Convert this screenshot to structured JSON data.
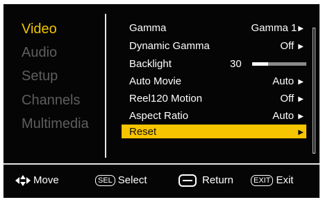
{
  "categories": [
    {
      "label": "Video",
      "active": true
    },
    {
      "label": "Audio",
      "active": false
    },
    {
      "label": "Setup",
      "active": false
    },
    {
      "label": "Channels",
      "active": false
    },
    {
      "label": "Multimedia",
      "active": false
    }
  ],
  "settings": [
    {
      "label": "Gamma",
      "value": "Gamma 1",
      "arrow": "▶"
    },
    {
      "label": "Dynamic Gamma",
      "value": "Off",
      "arrow": "▶"
    },
    {
      "label": "Backlight",
      "value": "30",
      "slider_level": 0.3
    },
    {
      "label": "Auto Movie",
      "value": "Auto",
      "arrow": "▶"
    },
    {
      "label": "Reel120 Motion",
      "value": "Off",
      "arrow": "▶"
    },
    {
      "label": "Aspect Ratio",
      "value": "Auto",
      "arrow": "▶"
    },
    {
      "label": "Reset",
      "value": "",
      "arrow": "▶",
      "selected": true
    }
  ],
  "footer": {
    "move_label": "Move",
    "sel_key": "SEL",
    "select_label": "Select",
    "return_label": "Return",
    "exit_key": "EXIT",
    "exit_label": "Exit"
  },
  "icons": {
    "move": "arrows-icon",
    "return": "return-key-icon"
  },
  "colors": {
    "background": "#050505",
    "active_category": "#f2c400",
    "inactive_category": "#5e5e5e",
    "selection_bar": "#f7c400",
    "text": "#ffffff"
  }
}
